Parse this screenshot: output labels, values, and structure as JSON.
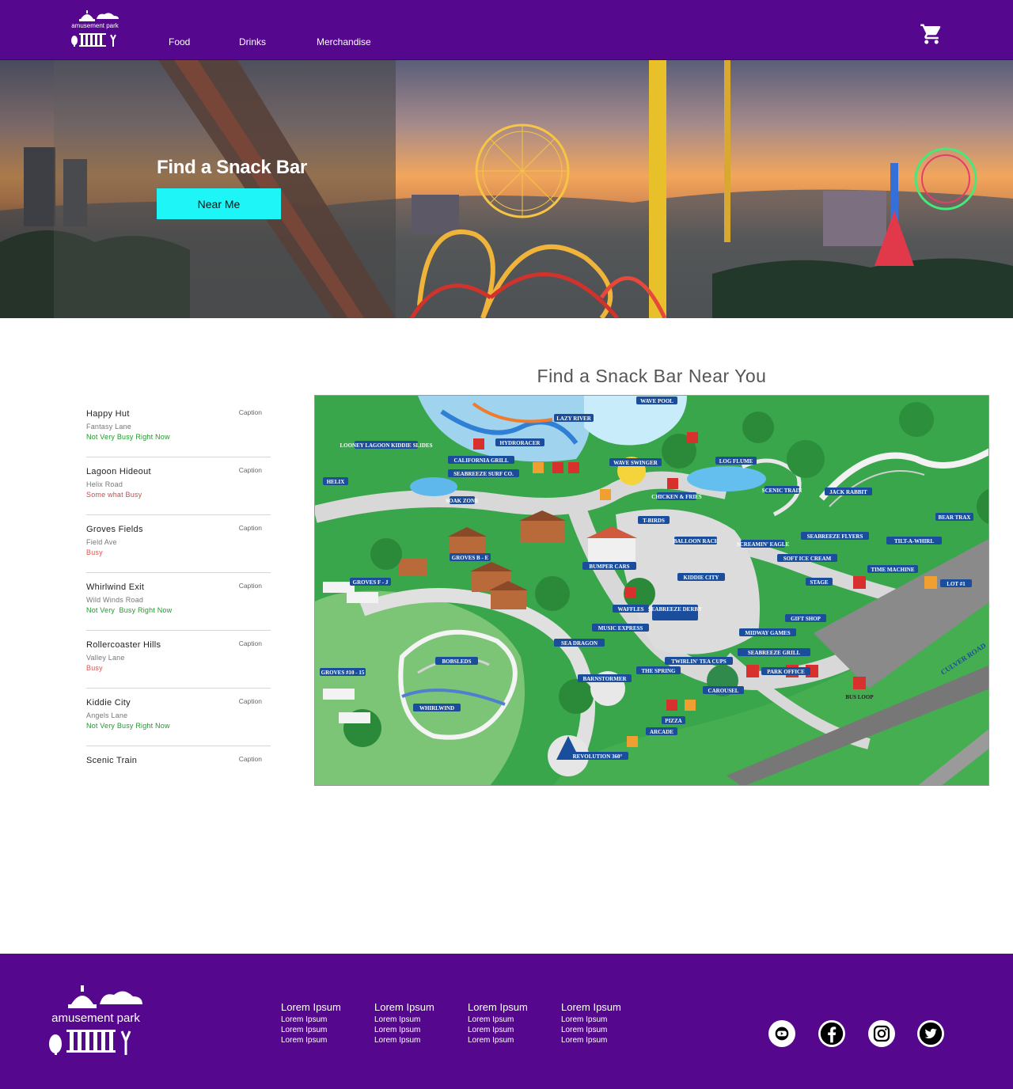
{
  "header": {
    "logo_text": "amusement park",
    "nav": [
      {
        "label": "Food"
      },
      {
        "label": "Drinks"
      },
      {
        "label": "Merchandise"
      }
    ],
    "cart_icon": "shopping-cart-icon"
  },
  "hero": {
    "title": "Find a Snack Bar",
    "button_label": "Near Me"
  },
  "main": {
    "title": "Find a Snack Bar Near You",
    "locations": [
      {
        "name": "Happy Hut",
        "caption": "Caption",
        "street": "Fantasy Lane",
        "status": "Not Very Busy Right Now",
        "status_color": "#1e9a2a"
      },
      {
        "name": "Lagoon Hideout",
        "caption": "Caption",
        "street": "Helix Road",
        "status": "Some what Busy",
        "status_color": "#c0504d"
      },
      {
        "name": "Groves Fields",
        "caption": "Caption",
        "street": "Field Ave",
        "status": "Busy",
        "status_color": "#e0554f"
      },
      {
        "name": "Whirlwind Exit",
        "caption": "Caption",
        "street": "Wild Winds Road",
        "status": "Not Very  Busy Right Now",
        "status_color": "#1e9a2a"
      },
      {
        "name": "Rollercoaster Hills",
        "caption": "Caption",
        "street": "Valley Lane",
        "status": "Busy",
        "status_color": "#e0554f"
      },
      {
        "name": "Kiddie City",
        "caption": "Caption",
        "street": "Angels Lane",
        "status": "Not Very Busy Right Now",
        "status_color": "#1e9a2a"
      },
      {
        "name": "Scenic Train",
        "caption": "Caption",
        "street": "",
        "status": "",
        "status_color": "#1e9a2a"
      }
    ],
    "map_labels": [
      "WAVE POOL",
      "LAZY RIVER",
      "LOONEY LAGOON KIDDIE SLIDES",
      "HYDRORACER",
      "CALIFORNIA GRILL",
      "SEABREEZE SURF CO.",
      "WAVE SWINGER",
      "LOG FLUME",
      "HELIX",
      "SOAK ZONE",
      "CHICKEN & FRIES",
      "SCENIC TRAIN",
      "JACK RABBIT",
      "BEAR TRAX",
      "T-BIRDS",
      "BALLOON RACE",
      "SCREAMIN' EAGLE",
      "SEABREEZE FLYERS",
      "TILT-A-WHIRL",
      "GROVES B - E",
      "BUMPER CARS",
      "SOFT ICE CREAM",
      "TIME MACHINE",
      "GROVES F - J",
      "KIDDIE CITY",
      "STAGE",
      "LOT #1",
      "WAFFLES",
      "SEABREEZE DERBY",
      "GIFT SHOP",
      "MUSIC EXPRESS",
      "SEA DRAGON",
      "MIDWAY GAMES",
      "BOBSLEDS",
      "SEABREEZE GRILL",
      "TWIRLIN' TEA CUPS",
      "GROVES #10 - 15",
      "THE SPRING",
      "PARK OFFICE",
      "CULVER ROAD",
      "BARNSTORMER",
      "CAROUSEL",
      "BUS LOOP",
      "WHIRLWIND",
      "PIZZA",
      "ARCADE",
      "REVOLUTION 360°"
    ]
  },
  "footer": {
    "logo_text": "amusement park",
    "columns": [
      {
        "heading": "Lorem Ipsum",
        "links": [
          "Lorem Ipsum",
          "Lorem Ipsum",
          "Lorem Ipsum"
        ]
      },
      {
        "heading": "Lorem Ipsum",
        "links": [
          "Lorem Ipsum",
          "Lorem Ipsum",
          "Lorem Ipsum"
        ]
      },
      {
        "heading": "Lorem Ipsum",
        "links": [
          "Lorem Ipsum",
          "Lorem Ipsum",
          "Lorem Ipsum"
        ]
      },
      {
        "heading": "Lorem Ipsum",
        "links": [
          "Lorem Ipsum",
          "Lorem Ipsum",
          "Lorem Ipsum"
        ]
      }
    ],
    "social": [
      "youtube-icon",
      "facebook-icon",
      "instagram-icon",
      "twitter-icon"
    ]
  },
  "colors": {
    "brand_purple": "#55088e",
    "accent_cyan": "#1df5f7",
    "status_green": "#1e9a2a",
    "status_red": "#e0554f"
  }
}
